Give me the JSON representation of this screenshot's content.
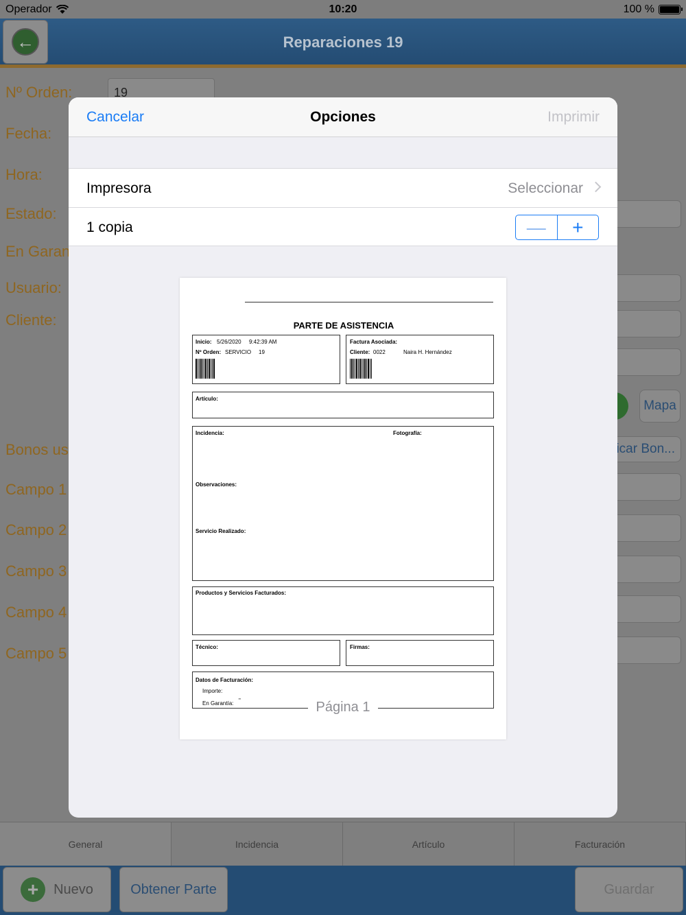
{
  "status_bar": {
    "carrier": "Operador",
    "time": "10:20",
    "battery": "100 %"
  },
  "nav": {
    "title": "Reparaciones 19"
  },
  "form": {
    "labels": {
      "orden": "Nº Orden:",
      "fecha": "Fecha:",
      "hora": "Hora:",
      "estado": "Estado:",
      "garantia": "En Garan",
      "usuario": "Usuario:",
      "cliente": "Cliente:",
      "bonos": "Bonos us",
      "campo1": "Campo 1",
      "campo2": "Campo 2",
      "campo3": "Campo 3",
      "campo4": "Campo 4",
      "campo5": "Campo 5"
    },
    "orden_value": "19",
    "mapa_label": "Mapa",
    "bonos_button": "icar Bon..."
  },
  "tabs": [
    "General",
    "Incidencia",
    "Artículo",
    "Facturación"
  ],
  "bottom_bar": {
    "nuevo": "Nuevo",
    "obtener_parte": "Obtener Parte",
    "guardar": "Guardar"
  },
  "modal": {
    "cancel": "Cancelar",
    "title": "Opciones",
    "print": "Imprimir",
    "printer_label": "Impresora",
    "printer_value": "Seleccionar",
    "copies_label": "1 copia",
    "stepper_minus": "—",
    "stepper_plus": "+",
    "page_label": "Página 1"
  },
  "preview": {
    "title": "PARTE DE ASISTENCIA",
    "inicio_label": "Inicio:",
    "inicio_date": "5/26/2020",
    "inicio_time": "9:42:39 AM",
    "orden_label": "Nº Orden:",
    "orden_type": "SERVICIO",
    "orden_num": "19",
    "factura_label": "Factura Asociada:",
    "cliente_label": "Cliente:",
    "cliente_code": "0022",
    "cliente_name": "Naira H. Hernández",
    "articulo_label": "Artículo:",
    "incidencia_label": "Incidencia:",
    "fotografia_label": "Fotografía:",
    "observaciones_label": "Observaciones:",
    "servicio_label": "Servicio Realizado:",
    "productos_label": "Productos y Servicios Facturados:",
    "tecnico_label": "Técnico:",
    "firmas_label": "Firmas:",
    "facturacion_label": "Datos de Facturación:",
    "importe_label": "Importe:",
    "garantia_label": "En Garantía:",
    "garantia_value": "\""
  },
  "colors": {
    "nav_blue": "#244c73",
    "accent_blue": "#1a7cf5",
    "label_orange": "#8f6620"
  }
}
